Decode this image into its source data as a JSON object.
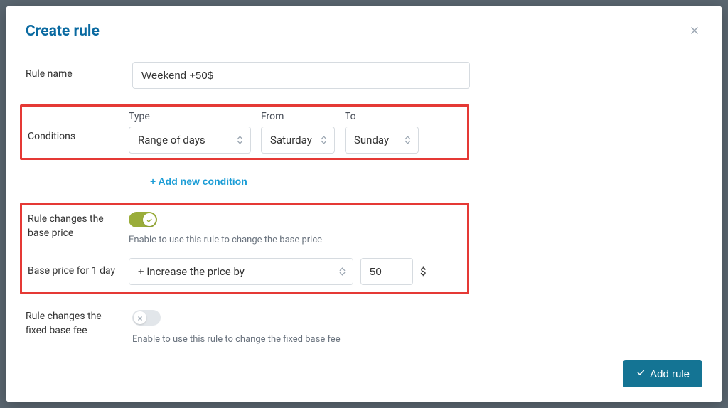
{
  "modal": {
    "title": "Create rule"
  },
  "fields": {
    "rule_name_label": "Rule name",
    "rule_name_value": "Weekend +50$",
    "conditions_label": "Conditions",
    "type_col_label": "Type",
    "from_col_label": "From",
    "to_col_label": "To",
    "type_value": "Range of days",
    "from_value": "Saturday",
    "to_value": "Sunday",
    "add_condition_label": "+ Add new condition",
    "changes_base_label": "Rule changes the base price",
    "changes_base_helper": "Enable to use this rule to change the base price",
    "base_price_label": "Base price for 1 day",
    "change_type_value": "+ Increase the price by",
    "change_amount_value": "50",
    "currency_symbol": "$",
    "changes_fee_label": "Rule changes the fixed base fee",
    "changes_fee_helper": "Enable to use this rule to change the fixed base fee"
  },
  "buttons": {
    "add_rule": "Add rule"
  }
}
